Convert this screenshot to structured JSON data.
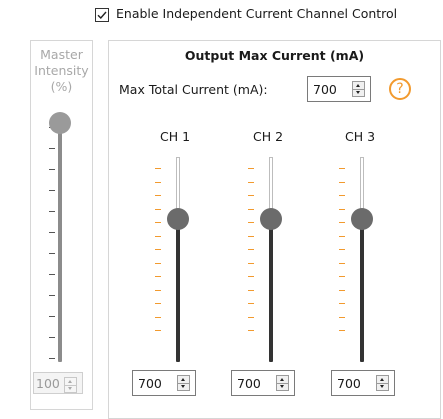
{
  "enable_checkbox": {
    "label": "Enable Independent Current Channel Control",
    "checked": true
  },
  "master": {
    "title_line1": "Master",
    "title_line2": "Intensity",
    "title_line3": "(%)",
    "value": "100",
    "level": 1.0,
    "enabled": false
  },
  "output": {
    "title": "Output Max Current (mA)",
    "max_total_label": "Max Total Current (mA):",
    "max_total_value": "700",
    "help_icon": "help-icon",
    "channels": [
      {
        "label": "CH 1",
        "value": "700",
        "level": 0.7
      },
      {
        "label": "CH 2",
        "value": "700",
        "level": 0.7
      },
      {
        "label": "CH 3",
        "value": "700",
        "level": 0.7
      }
    ]
  },
  "colors": {
    "tick_orange": "#f29a2e",
    "help_orange": "#f29a2e",
    "thumb_gray": "#6b6b6b",
    "disabled_gray": "#a8a8a8"
  }
}
